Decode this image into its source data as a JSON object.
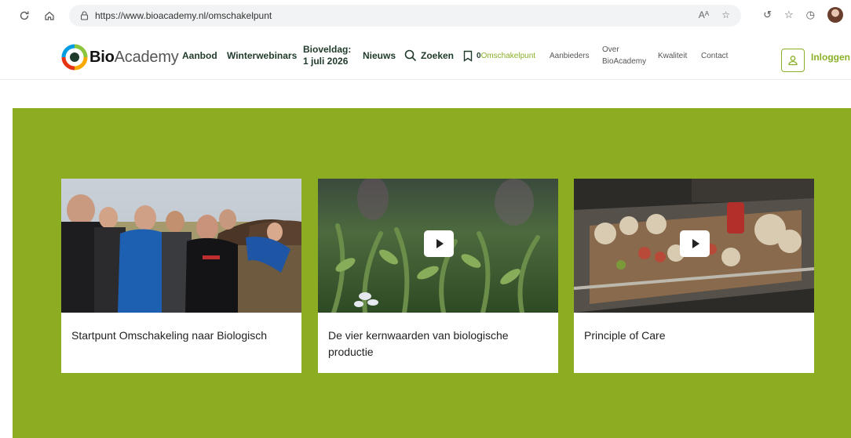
{
  "browser": {
    "url": "https://www.bioacademy.nl/omschakelpunt",
    "read_aloud_label": "Aᴬ"
  },
  "header": {
    "logo_bold": "Bio",
    "logo_light": "Academy",
    "nav": {
      "aanbod": "Aanbod",
      "winterwebinars": "Winterwebinars",
      "bioveldag_line1": "Bioveldag:",
      "bioveldag_line2": "1 juli 2026",
      "nieuws": "Nieuws",
      "zoeken": "Zoeken",
      "bookmark_count": "0",
      "omschakelpunt": "Omschakelpunt",
      "aanbieders": "Aanbieders",
      "over_line1": "Over",
      "over_line2": "BioAcademy",
      "kwaliteit": "Kwaliteit",
      "contact": "Contact"
    },
    "login": "Inloggen"
  },
  "cards": [
    {
      "title": "Startpunt Omschakeling naar Biologisch",
      "has_video": false
    },
    {
      "title": "De vier kernwaarden van biologische productie",
      "has_video": true
    },
    {
      "title": "Principle of Care",
      "has_video": true
    }
  ],
  "colors": {
    "brand_green": "#8cad22",
    "nav_text": "#1f3a2a",
    "accent_green": "#8ab027"
  }
}
